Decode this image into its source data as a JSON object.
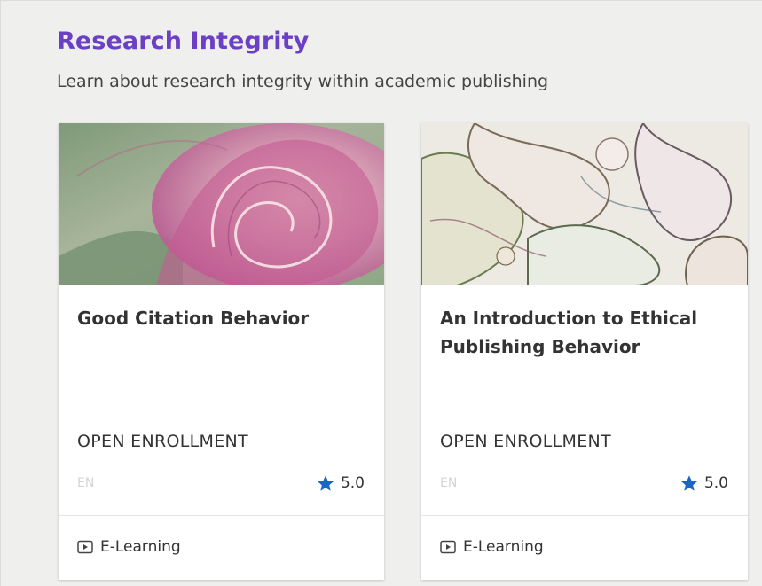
{
  "section": {
    "title": "Research Integrity",
    "subtitle": "Learn about research integrity within academic publishing"
  },
  "cards": [
    {
      "title": "Good Citation Behavior",
      "enrollment": "OPEN ENROLLMENT",
      "language": "EN",
      "rating": "5.0",
      "format": "E-Learning",
      "image_icon": "pink-leaf-spiral-image"
    },
    {
      "title": "An Introduction to Ethical Publishing Behavior",
      "enrollment": "OPEN ENROLLMENT",
      "language": "EN",
      "rating": "5.0",
      "format": "E-Learning",
      "image_icon": "cell-structure-image"
    }
  ],
  "colors": {
    "accent": "#6b40c6",
    "star": "#1a66c4",
    "background": "#efefed"
  }
}
